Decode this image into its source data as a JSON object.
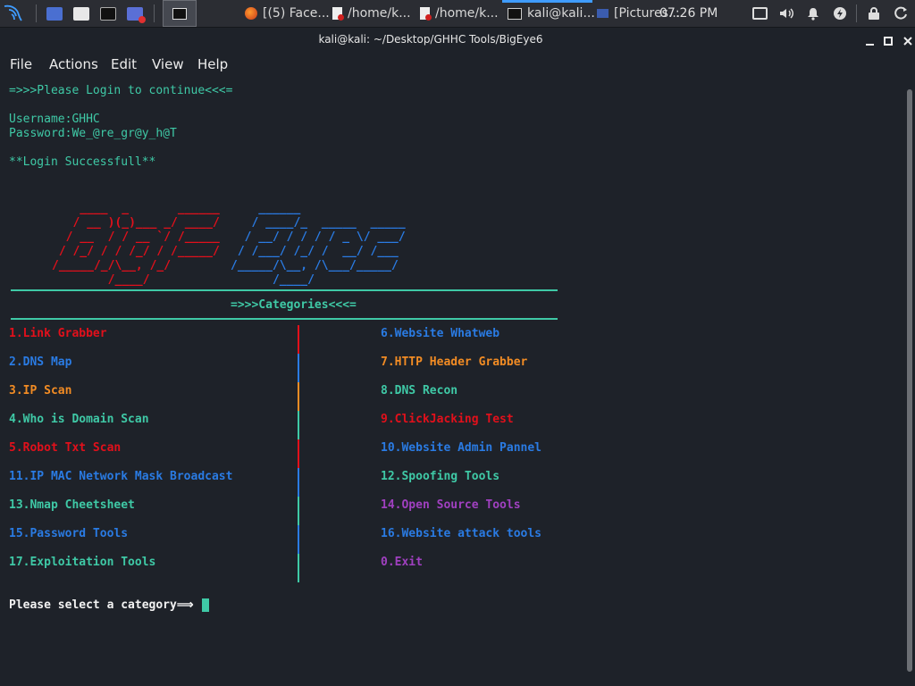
{
  "taskbar": {
    "tasks": [
      {
        "label": "[(5) Face..."
      },
      {
        "label": "/home/k..."
      },
      {
        "label": "/home/k..."
      },
      {
        "label": "kali@kali..."
      },
      {
        "label": "[Pictures..."
      }
    ],
    "clock": "07:26 PM"
  },
  "window": {
    "title": "kali@kali: ~/Desktop/GHHC Tools/BigEye6"
  },
  "menu": {
    "file": "File",
    "actions": "Actions",
    "edit": "Edit",
    "view": "View",
    "help": "Help"
  },
  "terminal": {
    "login_prompt": "=>>>Please Login to continue<<<=",
    "username_line": "Username:GHHC",
    "password_line": "Password:We_@re_gr@y_h@T",
    "login_success": "**Login Successfull**",
    "banner_big": {
      "line1": "    ____  _       ______",
      "line2": "   / __ )(_)___ _/ ____/",
      "line3": "  / __  / / __ `/ /_____",
      "line4": " / /_/ / / /_/ / /_____/",
      "line5": "/_____/_/\\__, /_/      ",
      "line6": "        /____/         "
    },
    "banner_eye": {
      "line1": "    ______                  ",
      "line2": "   / ____/_  _____  _____   ",
      "line3": "  / __/ / / / / _ \\/ ___/   ",
      "line4": " / /___/ /_/ /  __/ /___    ",
      "line5": "/_____/\\__, /\\___/_____/   ",
      "line6": "      /____/               "
    },
    "categories_header": "=>>>Categories<<<=",
    "categories_left": [
      {
        "label": "1.Link Grabber",
        "color": "red"
      },
      {
        "label": "2.DNS Map",
        "color": "blue"
      },
      {
        "label": "3.IP Scan",
        "color": "orange"
      },
      {
        "label": "4.Who is Domain Scan",
        "color": "teal"
      },
      {
        "label": "5.Robot Txt Scan",
        "color": "red"
      },
      {
        "label": "11.IP MAC Network Mask Broadcast",
        "color": "blue"
      },
      {
        "label": "13.Nmap Cheetsheet",
        "color": "teal"
      },
      {
        "label": "15.Password Tools",
        "color": "blue"
      },
      {
        "label": "17.Exploitation Tools",
        "color": "teal"
      }
    ],
    "categories_right": [
      {
        "label": "6.Website Whatweb",
        "color": "blue"
      },
      {
        "label": "7.HTTP Header Grabber",
        "color": "orange"
      },
      {
        "label": "8.DNS Recon",
        "color": "teal"
      },
      {
        "label": "9.ClickJacking Test",
        "color": "red"
      },
      {
        "label": "10.Website Admin Pannel",
        "color": "blue"
      },
      {
        "label": "12.Spoofing Tools",
        "color": "teal"
      },
      {
        "label": "14.Open Source Tools",
        "color": "purple"
      },
      {
        "label": "16.Website attack tools",
        "color": "blue"
      },
      {
        "label": "0.Exit",
        "color": "purple"
      }
    ],
    "select_prompt": "Please select a category⟹"
  },
  "colors": {
    "background": "#1e2229",
    "teal": "#3fc9a6",
    "red": "#e2101b",
    "blue": "#2a7be3",
    "orange": "#f28c24",
    "purple": "#a040c0"
  }
}
